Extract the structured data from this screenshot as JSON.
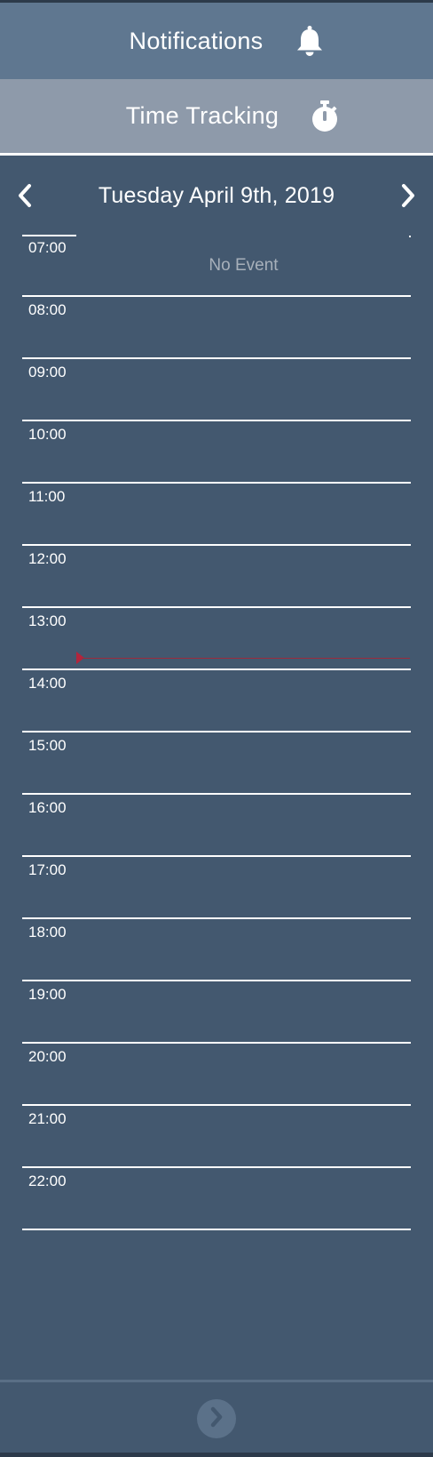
{
  "header": {
    "notifications_label": "Notifications",
    "notifications_icon": "bell-icon",
    "time_tracking_label": "Time Tracking",
    "time_tracking_icon": "stopwatch-icon"
  },
  "calendar": {
    "date_title": "Tuesday April 9th, 2019",
    "prev_icon": "chevron-left-icon",
    "next_icon": "chevron-right-icon",
    "empty_text": "No Event",
    "hours": [
      "07:00",
      "08:00",
      "09:00",
      "10:00",
      "11:00",
      "12:00",
      "13:00",
      "14:00",
      "15:00",
      "16:00",
      "17:00",
      "18:00",
      "19:00",
      "20:00",
      "21:00",
      "22:00"
    ],
    "current_time_indicator_color": "#b2253c"
  },
  "footer": {
    "next_button_icon": "chevron-right-circle-icon"
  },
  "colors": {
    "background": "#43586f",
    "notifications_bar": "#5f7790",
    "time_tracking_bar": "#8e9aaa",
    "muted_text": "#a7b0ba"
  }
}
